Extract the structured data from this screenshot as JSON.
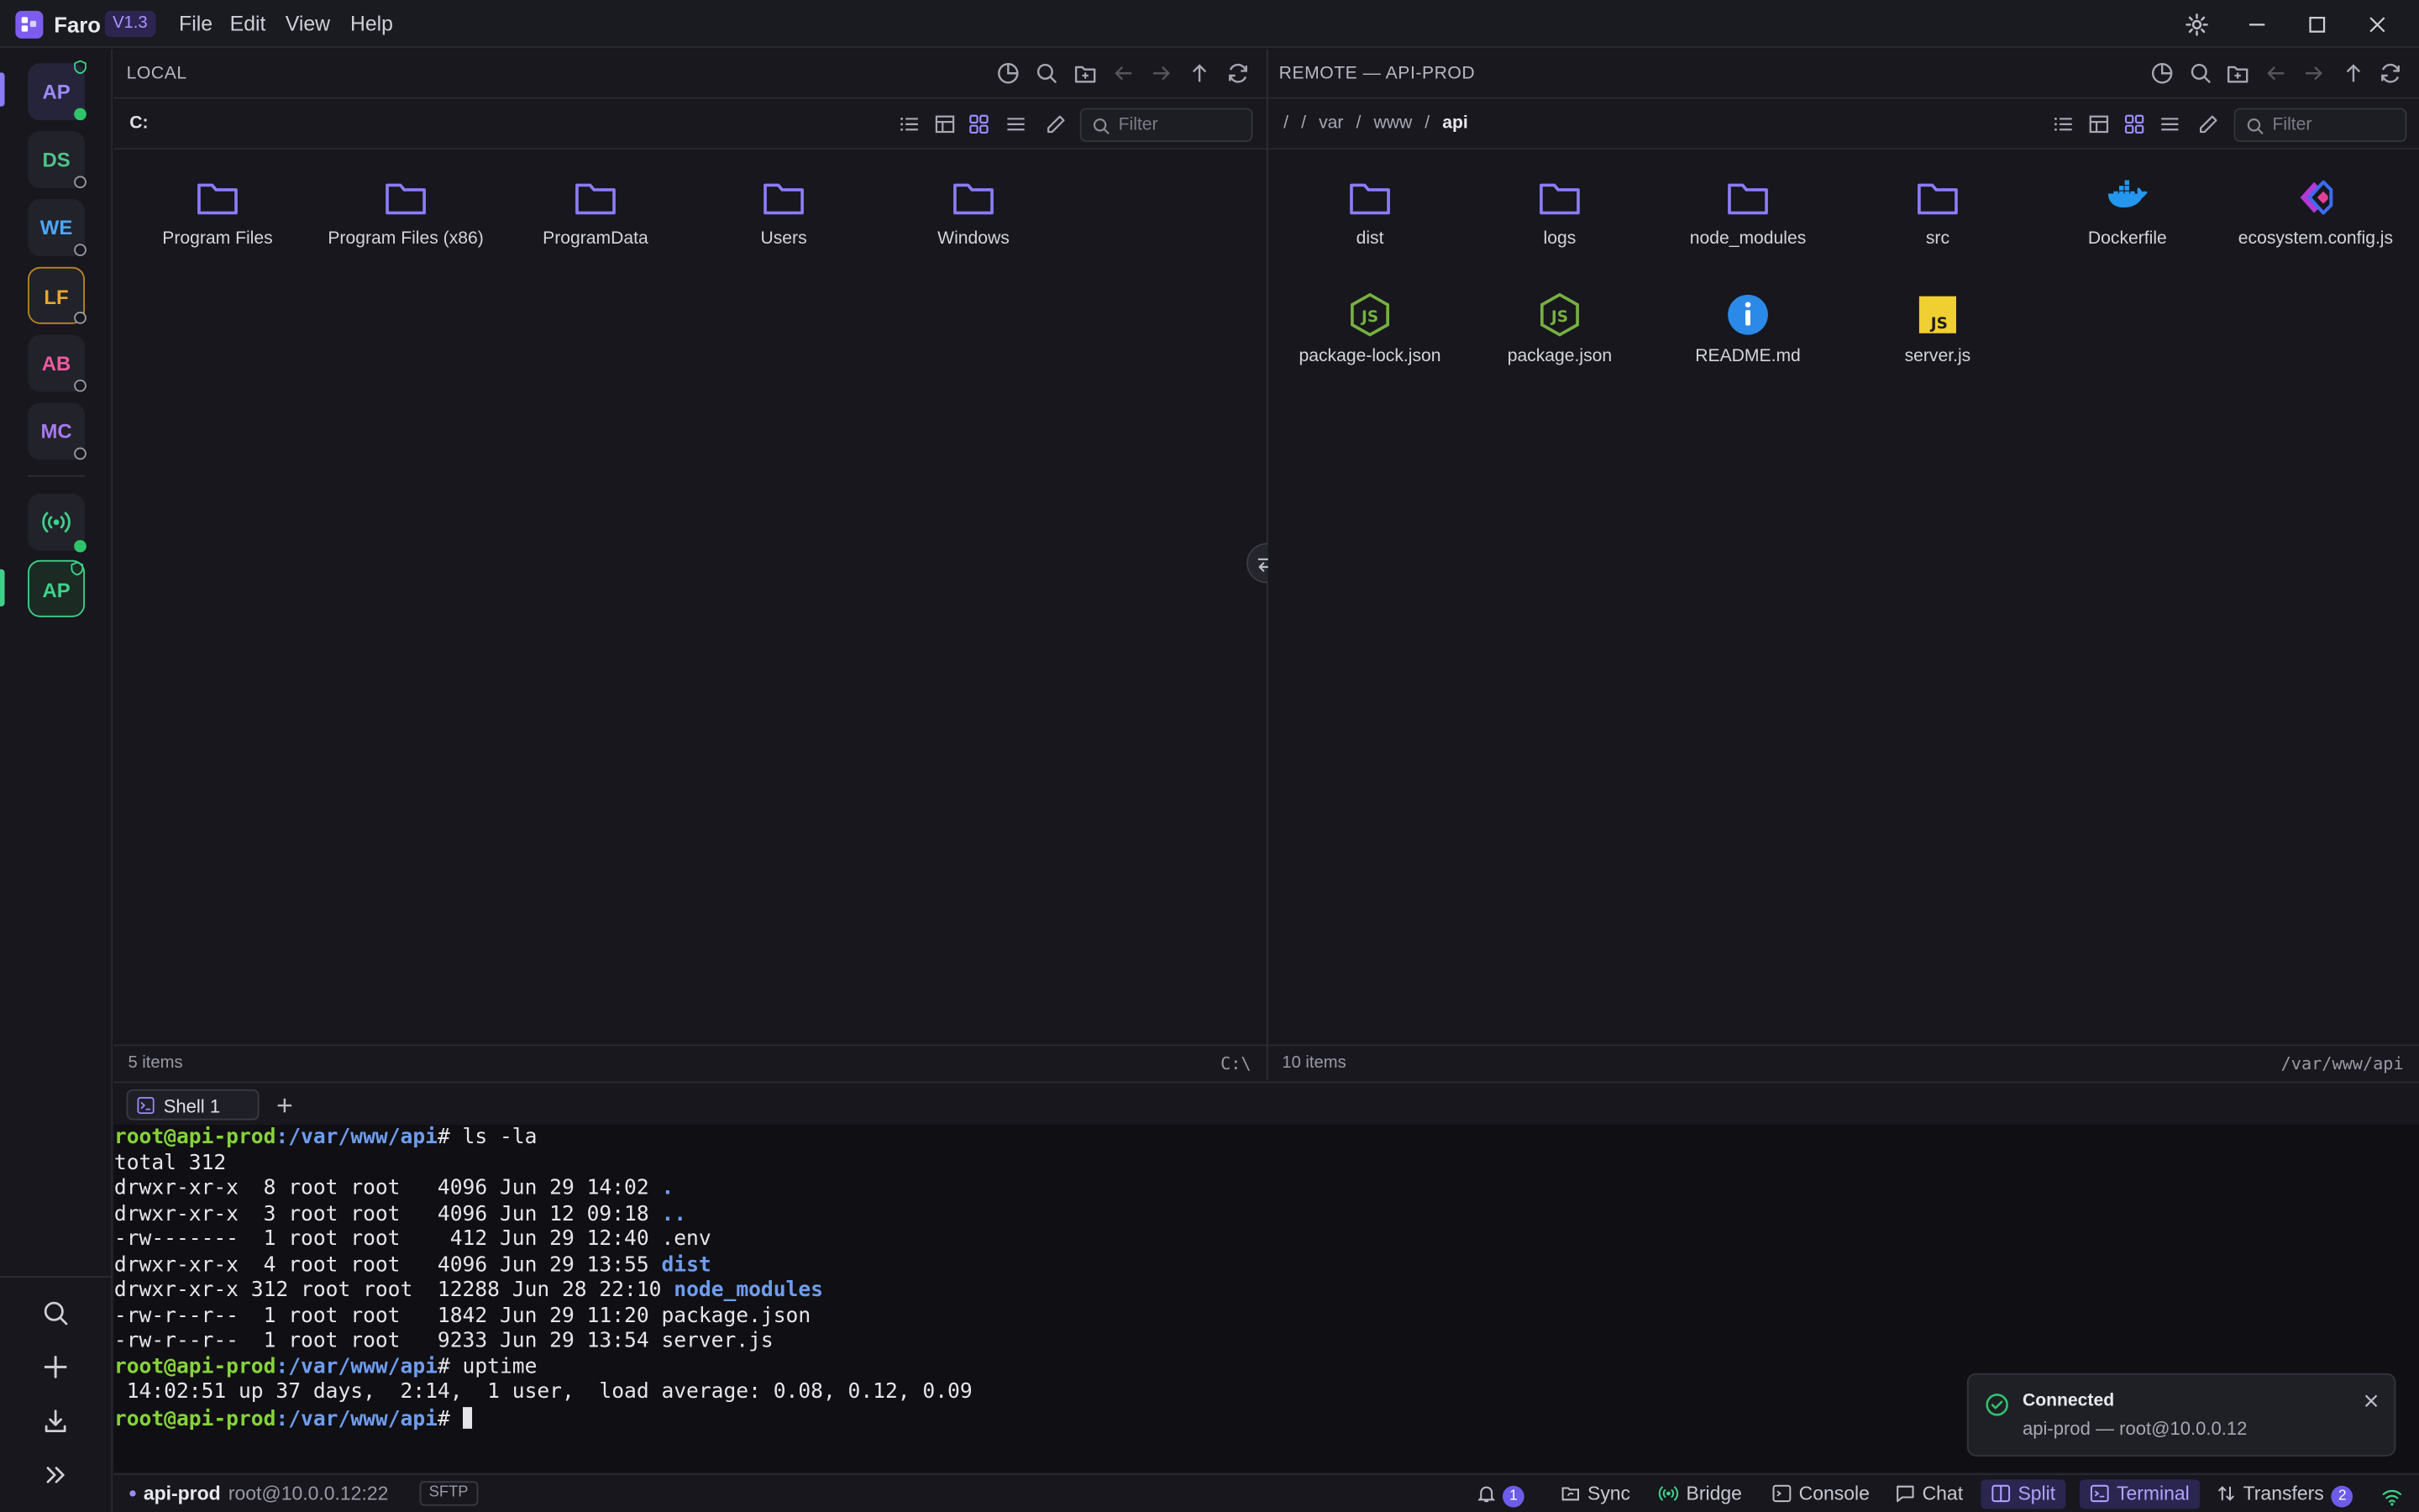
{
  "app": {
    "name": "Faro",
    "version": "V1.3"
  },
  "menu": [
    "File",
    "Edit",
    "View",
    "Help"
  ],
  "rail": {
    "sessions": [
      {
        "label": "AP",
        "color": "#9a8cff",
        "status": "connected"
      },
      {
        "label": "DS",
        "color": "#4ec48a",
        "status": "idle"
      },
      {
        "label": "WE",
        "color": "#4aa8ff",
        "status": "idle"
      },
      {
        "label": "LF",
        "color": "#e8a82e",
        "status": "idle"
      },
      {
        "label": "AB",
        "color": "#ef5aa0",
        "status": "idle"
      },
      {
        "label": "MC",
        "color": "#a779f5",
        "status": "idle"
      }
    ],
    "active_session": {
      "label": "AP",
      "color": "#3fd18a"
    }
  },
  "local": {
    "title": "LOCAL",
    "path": "C:",
    "filter_placeholder": "Filter",
    "items": [
      {
        "name": "Program Files",
        "type": "folder"
      },
      {
        "name": "Program Files (x86)",
        "type": "folder"
      },
      {
        "name": "ProgramData",
        "type": "folder"
      },
      {
        "name": "Users",
        "type": "folder"
      },
      {
        "name": "Windows",
        "type": "folder"
      }
    ],
    "count": "5 items",
    "footer_path": "C:\\"
  },
  "remote": {
    "title": "REMOTE — API-PROD",
    "breadcrumb": [
      "/",
      "var",
      "www",
      "api"
    ],
    "filter_placeholder": "Filter",
    "items": [
      {
        "name": "dist",
        "type": "folder"
      },
      {
        "name": "logs",
        "type": "folder"
      },
      {
        "name": "node_modules",
        "type": "folder"
      },
      {
        "name": "src",
        "type": "folder"
      },
      {
        "name": "Dockerfile",
        "type": "docker"
      },
      {
        "name": "ecosystem.config.js",
        "type": "pm2"
      },
      {
        "name": "package-lock.json",
        "type": "node"
      },
      {
        "name": "package.json",
        "type": "node"
      },
      {
        "name": "README.md",
        "type": "info"
      },
      {
        "name": "server.js",
        "type": "js"
      }
    ],
    "count": "10 items",
    "footer_path": "/var/www/api"
  },
  "terminal": {
    "tab": "Shell 1",
    "lines": [
      {
        "prompt": true,
        "user": "root@api-prod",
        "path": ":/var/www/api",
        "cmd": "# ls -la"
      },
      {
        "text": "total 312"
      },
      {
        "text": "drwxr-xr-x  8 root root   4096 Jun 29 14:02 ",
        "link": "."
      },
      {
        "text": "drwxr-xr-x  3 root root   4096 Jun 12 09:18 ",
        "link": ".."
      },
      {
        "text": "-rw-------  1 root root    412 Jun 29 12:40 .env"
      },
      {
        "text": "drwxr-xr-x  4 root root   4096 Jun 29 13:55 ",
        "link": "dist"
      },
      {
        "text": "drwxr-xr-x 312 root root  12288 Jun 28 22:10 ",
        "link": "node_modules"
      },
      {
        "text": "-rw-r--r--  1 root root   1842 Jun 29 11:20 package.json"
      },
      {
        "text": "-rw-r--r--  1 root root   9233 Jun 29 13:54 server.js"
      },
      {
        "prompt": true,
        "user": "root@api-prod",
        "path": ":/var/www/api",
        "cmd": "# uptime"
      },
      {
        "text": " 14:02:51 up 37 days,  2:14,  1 user,  load average: 0.08, 0.12, 0.09"
      },
      {
        "prompt": true,
        "user": "root@api-prod",
        "path": ":/var/www/api",
        "cmd": "# ",
        "cursor": true
      }
    ]
  },
  "statusbar": {
    "session": "api-prod",
    "host": "root@10.0.0.12:22",
    "protocol": "SFTP",
    "notifications": "1",
    "sync": "Sync",
    "bridge": "Bridge",
    "console": "Console",
    "chat": "Chat",
    "split": "Split",
    "terminal": "Terminal",
    "transfers": "Transfers",
    "transfers_count": "2"
  },
  "toast": {
    "title": "Connected",
    "message": "api-prod — root@10.0.0.12"
  },
  "colors": {
    "accent": "#7c5cf0",
    "folder": "#8b7cf6",
    "success": "#2fc46a"
  }
}
